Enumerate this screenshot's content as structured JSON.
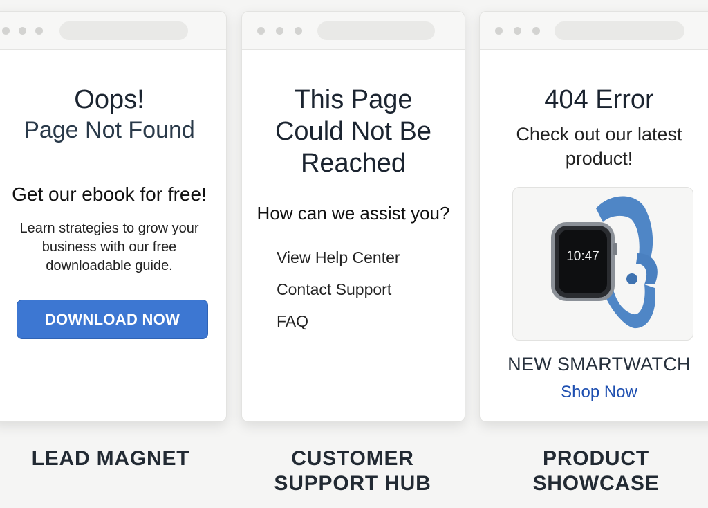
{
  "cards": [
    {
      "title": "Oops!",
      "subtitle": "Page Not Found",
      "offer_heading": "Get our ebook for free!",
      "description": "Learn strategies to grow your business with our free downloadable guide.",
      "button_label": "DOWNLOAD NOW",
      "caption": "LEAD MAGNET"
    },
    {
      "title": "This Page Could Not Be Reached",
      "question": "How can we assist you?",
      "links": [
        "View Help Center",
        "Contact Support",
        "FAQ"
      ],
      "caption": "CUSTOMER SUPPORT HUB"
    },
    {
      "title": "404 Error",
      "subtitle": "Check out our latest product!",
      "product_time": "10:47",
      "product_name": "NEW SMARTWATCH",
      "cta": "Shop Now",
      "caption": "PRODUCT SHOWCASE"
    }
  ],
  "colors": {
    "button_blue": "#3d77d2",
    "link_blue": "#1e4fb0",
    "watch_band": "#4f86c6"
  }
}
